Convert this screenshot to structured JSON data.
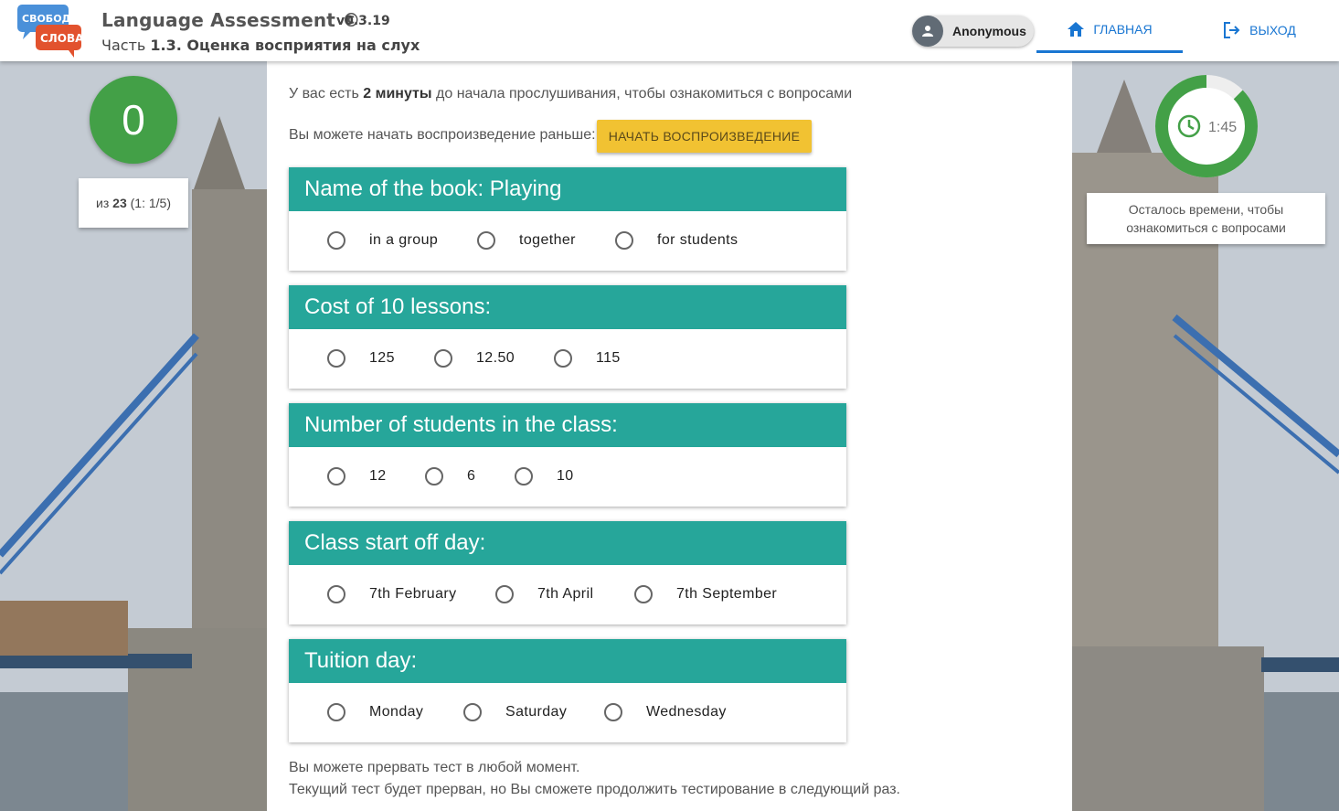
{
  "header": {
    "logo_top": "СВОБОДА",
    "logo_bottom": "СЛОВА",
    "title": "Language Assessment ©",
    "version": "v0.3.19",
    "subtitle_prefix": "Часть ",
    "subtitle_bold": "1.3. Оценка восприятия на слух",
    "user": "Anonymous",
    "nav_home": "ГЛАВНАЯ",
    "nav_exit": "ВЫХОД"
  },
  "score": {
    "value": "0",
    "detail_prefix": "из ",
    "detail_total": "23",
    "detail_suffix": " (1: 1/5)"
  },
  "timer": {
    "time": "1:45",
    "remaining_fraction": 0.875,
    "label_line1": "Осталось времени, чтобы",
    "label_line2": "ознакомиться с вопросами"
  },
  "intro": {
    "before": "У вас есть ",
    "bold": "2 минуты",
    "after": " до начала прослушивания, чтобы ознакомиться с вопросами",
    "early": "Вы можете начать воспроизведение раньше:",
    "play_button": "НАЧАТЬ ВОСПРОИЗВЕДЕНИЕ"
  },
  "questions": [
    {
      "title": "Name of the book: Playing",
      "options": [
        "in a group",
        "together",
        "for students"
      ]
    },
    {
      "title": "Cost of 10 lessons:",
      "options": [
        "125",
        "12.50",
        "115"
      ]
    },
    {
      "title": "Number of students in the class:",
      "options": [
        "12",
        "6",
        "10"
      ]
    },
    {
      "title": "Class start off day:",
      "options": [
        "7th February",
        "7th April",
        "7th September"
      ]
    },
    {
      "title": "Tuition day:",
      "options": [
        "Monday",
        "Saturday",
        "Wednesday"
      ]
    }
  ],
  "footer": {
    "line1": "Вы можете прервать тест в любой момент.",
    "line2": "Текущий тест будет прерван, но Вы сможете продолжить тестирование в следующий раз."
  },
  "colors": {
    "accent": "#1976d2",
    "question_header": "#26a69a",
    "score": "#43a047",
    "play_button": "#f1c232"
  }
}
